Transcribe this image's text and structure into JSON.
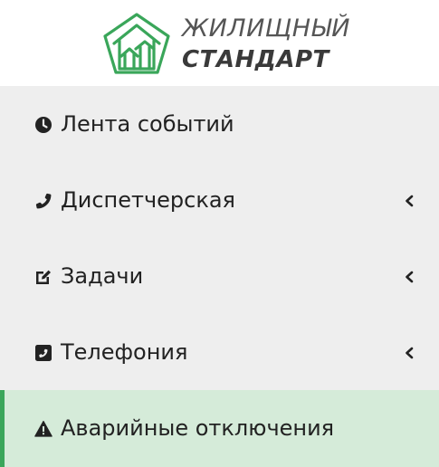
{
  "logo": {
    "line1": "ЖИЛИЩНЫЙ",
    "line2": "СТАНДАРТ",
    "icon": "house-pentagon-logo",
    "accent_color": "#3aa65a"
  },
  "nav": {
    "items": [
      {
        "label": "Лента событий",
        "icon": "clock-icon",
        "has_submenu": false,
        "active": false
      },
      {
        "label": "Диспетчерская",
        "icon": "phone-icon",
        "has_submenu": true,
        "active": false
      },
      {
        "label": "Задачи",
        "icon": "edit-icon",
        "has_submenu": true,
        "active": false
      },
      {
        "label": "Телефония",
        "icon": "phone-square-icon",
        "has_submenu": true,
        "active": false
      },
      {
        "label": "Аварийные отключения",
        "icon": "warning-icon",
        "has_submenu": false,
        "active": true
      }
    ]
  },
  "colors": {
    "active_background": "#d5ebd9",
    "active_border": "#3aa65a",
    "nav_background": "#eeeeee"
  }
}
